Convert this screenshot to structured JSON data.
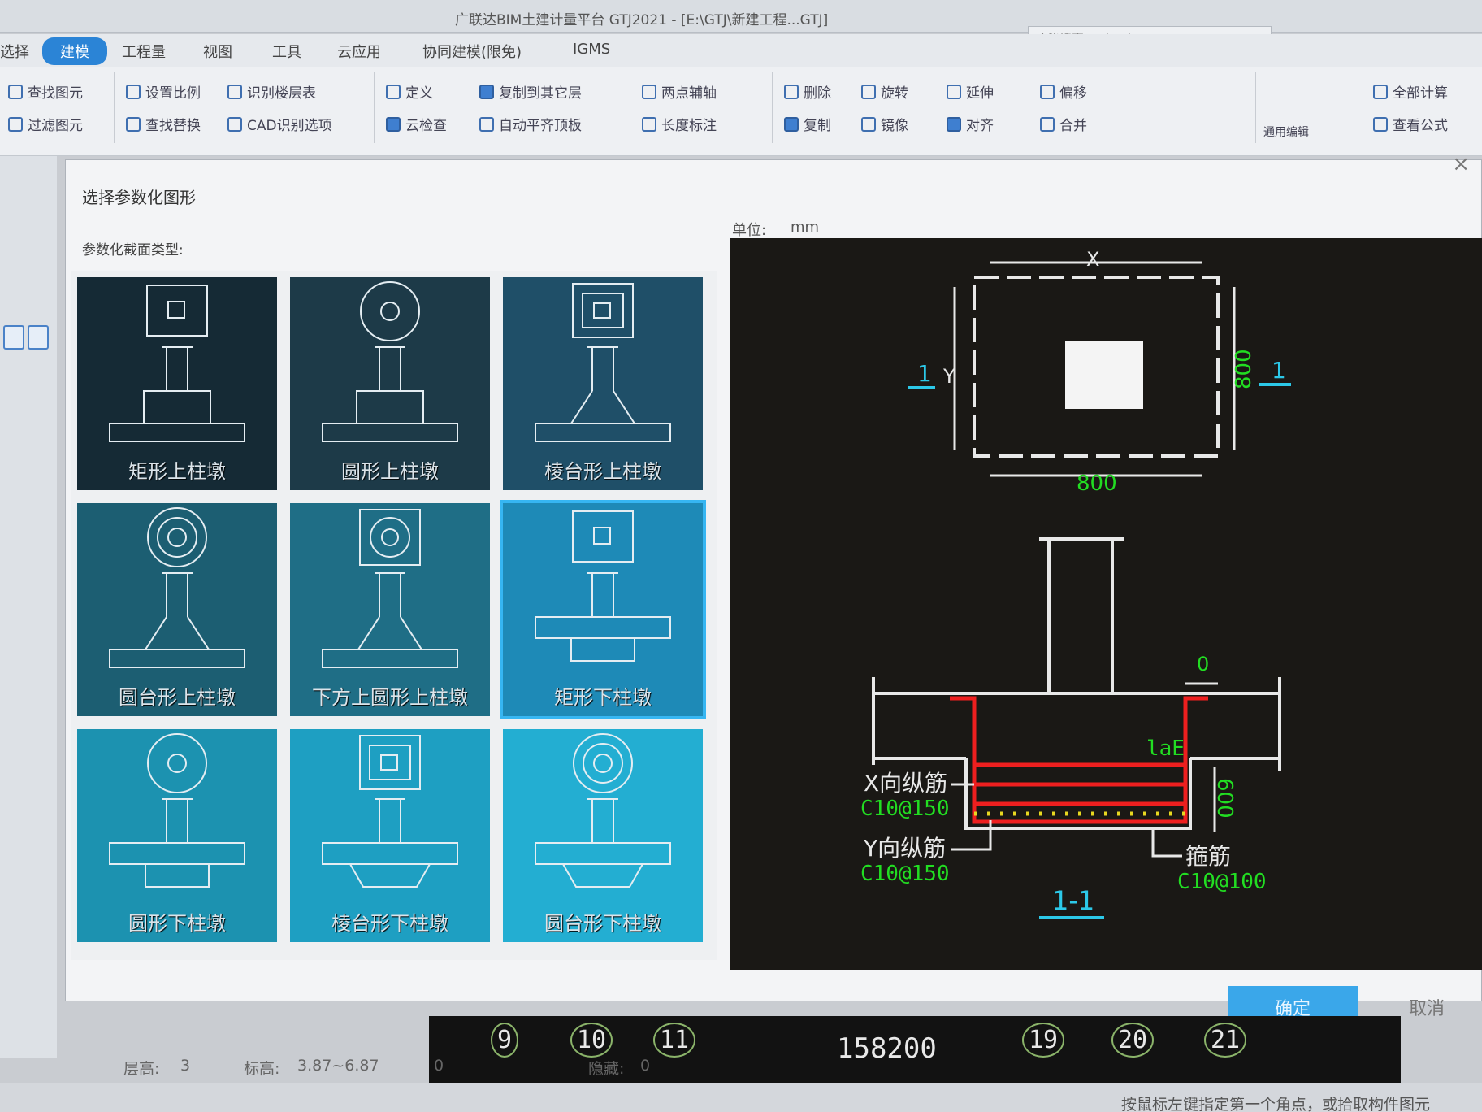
{
  "window": {
    "title": "广联达BIM土建计量平台 GTJ2021 - [E:\\GTJ\\新建工程...GTJ]",
    "search_placeholder": "功能搜索 Ctrl+Alt+E"
  },
  "ribbon": {
    "tabs": [
      "选择",
      "建模",
      "工程量",
      "视图",
      "工具",
      "云应用",
      "协同建模(限免)",
      "IGMS"
    ],
    "active_tab": "建模",
    "items": {
      "find_element": "查找图元",
      "filter_element": "过滤图元",
      "set_ratio": "设置比例",
      "identify_floor_table": "识别楼层表",
      "find_replace": "查找替换",
      "cad_options": "CAD识别选项",
      "define": "定义",
      "cloud_check": "云检查",
      "copy_to_floors": "复制到其它层",
      "auto_level_slab": "自动平齐顶板",
      "two_point_axis": "两点辅轴",
      "length_dim": "长度标注",
      "delete": "删除",
      "copy": "复制",
      "rotate": "旋转",
      "mirror": "镜像",
      "extend": "延伸",
      "align": "对齐",
      "offset": "偏移",
      "merge": "合并",
      "general_edit": "通用编辑",
      "total_calc": "全部计算",
      "view_formula": "查看公式"
    }
  },
  "dialog": {
    "title": "选择参数化图形",
    "unit_label": "单位:",
    "unit_value": "mm",
    "section_type_label": "参数化截面类型:",
    "options": [
      {
        "label": "矩形上柱墩",
        "top": "square",
        "body": "upper-rect",
        "bg": "#152a35"
      },
      {
        "label": "圆形上柱墩",
        "top": "circle",
        "body": "upper-rect",
        "bg": "#1d3a48"
      },
      {
        "label": "棱台形上柱墩",
        "top": "frustum-square",
        "body": "upper-trap",
        "bg": "#1f4f68"
      },
      {
        "label": "圆台形上柱墩",
        "top": "double-circle",
        "body": "upper-trap",
        "bg": "#1c5e72"
      },
      {
        "label": "下方上圆形上柱墩",
        "top": "square-circle",
        "body": "upper-trap",
        "bg": "#1f6e86"
      },
      {
        "label": "矩形下柱墩",
        "top": "square",
        "body": "lower-rect",
        "bg": "#1e8ab7"
      },
      {
        "label": "圆形下柱墩",
        "top": "circle",
        "body": "lower-rect",
        "bg": "#1c92b0"
      },
      {
        "label": "棱台形下柱墩",
        "top": "frustum-square",
        "body": "lower-trap",
        "bg": "#1e9fc2"
      },
      {
        "label": "圆台形下柱墩",
        "top": "double-circle",
        "body": "lower-trap",
        "bg": "#23aed2"
      }
    ],
    "selected_index": 5,
    "ok_label": "确定",
    "cancel_label": "取消"
  },
  "preview": {
    "plan_x": "X",
    "plan_y": "Y",
    "plan_width": "800",
    "plan_depth": "800",
    "section_mark": "1",
    "top_offset": "0",
    "anchor": "laE",
    "depth": "600",
    "x_rebar_label": "X向纵筋",
    "x_rebar_value": "C10@150",
    "y_rebar_label": "Y向纵筋",
    "y_rebar_value": "C10@150",
    "stirrup_label": "箍筋",
    "stirrup_value": "C10@100",
    "section_title": "1-1"
  },
  "bottom": {
    "axis_numbers": [
      "9",
      "10",
      "11",
      "19",
      "20",
      "21"
    ],
    "axis_dimension": "158200",
    "floor_height_label": "层高:",
    "floor_height_value": "3",
    "elevation_label": "标高:",
    "elevation_value": "3.87~6.87",
    "zero": "0",
    "hidden_label": "隐藏:",
    "hidden_value": "0",
    "status_text": "按鼠标左键指定第一个角点，或拾取构件图元"
  }
}
